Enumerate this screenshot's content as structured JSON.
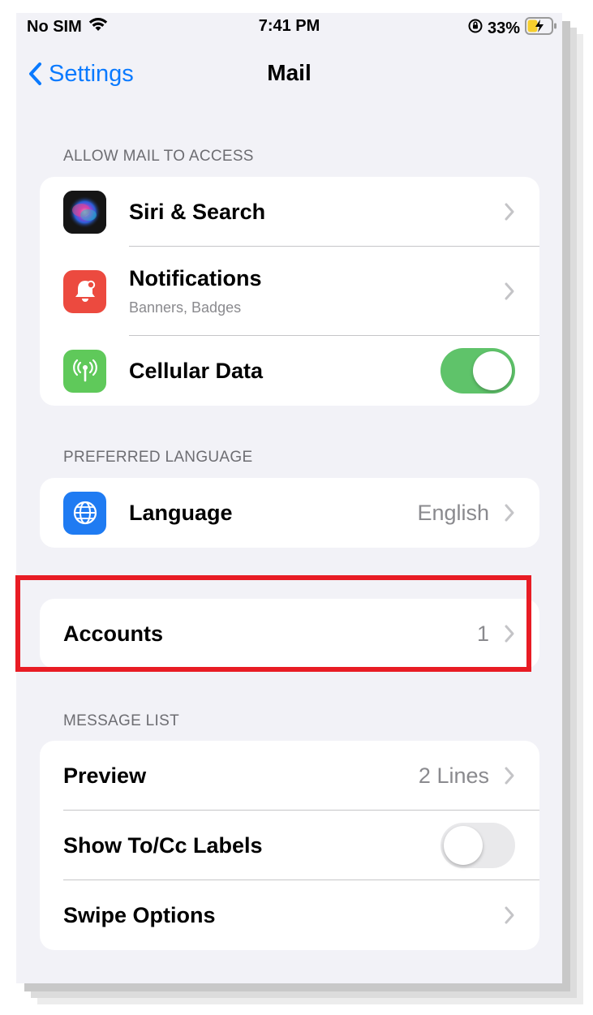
{
  "status_bar": {
    "carrier": "No SIM",
    "time": "7:41 PM",
    "battery": "33%"
  },
  "nav": {
    "back_label": "Settings",
    "title": "Mail"
  },
  "allow_access": {
    "header": "ALLOW MAIL TO ACCESS",
    "siri": {
      "label": "Siri & Search",
      "icon": "siri-icon"
    },
    "notifications": {
      "label": "Notifications",
      "sublabel": "Banners, Badges",
      "icon": "notification-bell-icon",
      "color": "#ec4a3f"
    },
    "cellular": {
      "label": "Cellular Data",
      "icon": "antenna-icon",
      "color": "#5fc95a",
      "toggle_on": true
    }
  },
  "preferred_language": {
    "header": "PREFERRED LANGUAGE",
    "language": {
      "label": "Language",
      "value": "English",
      "icon": "globe-icon",
      "color": "#1f7bf2"
    }
  },
  "accounts": {
    "label": "Accounts",
    "value": "1"
  },
  "message_list": {
    "header": "MESSAGE LIST",
    "preview": {
      "label": "Preview",
      "value": "2 Lines"
    },
    "show_to_cc": {
      "label": "Show To/Cc Labels",
      "toggle_on": false
    },
    "swipe": {
      "label": "Swipe Options"
    }
  },
  "colors": {
    "accent": "#0a7aff",
    "toggle_on": "#5fc36a",
    "toggle_off": "#e9e9eb",
    "highlight": "#e81c24"
  }
}
